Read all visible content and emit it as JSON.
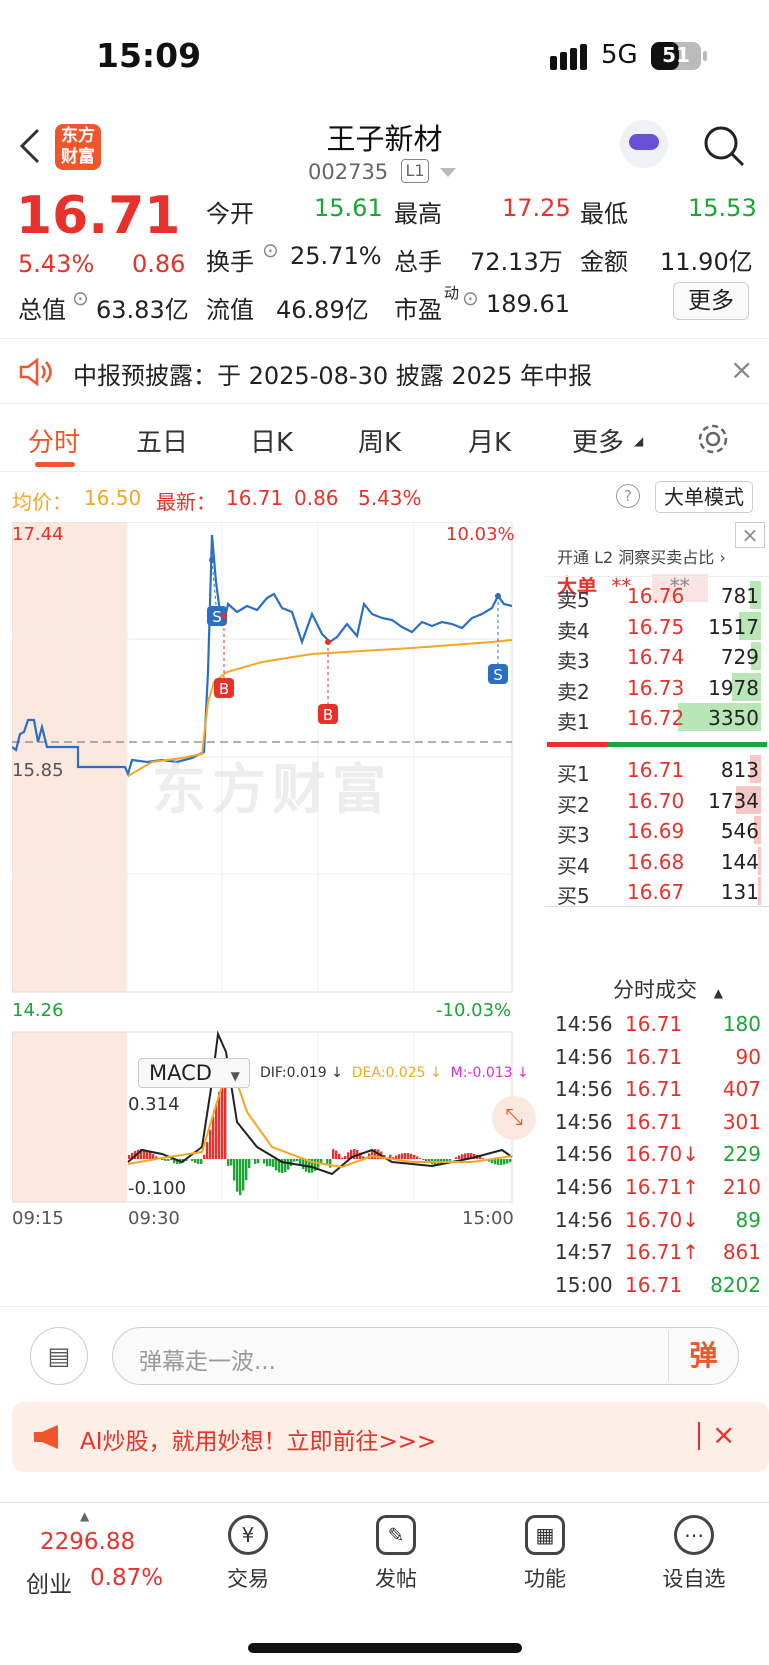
{
  "status": {
    "time": "15:09",
    "network": "5G",
    "battery": "51"
  },
  "header": {
    "logo_text": "东方财富",
    "stock_name": "王子新材",
    "stock_code": "002735",
    "level": "L1"
  },
  "quote": {
    "price": "16.71",
    "change_pct": "5.43%",
    "change": "0.86",
    "open_label": "今开",
    "open": "15.61",
    "high_label": "最高",
    "high": "17.25",
    "low_label": "最低",
    "low": "15.53",
    "turnover_label": "换手",
    "turnover": "25.71%",
    "volume_label": "总手",
    "volume": "72.13万",
    "amount_label": "金额",
    "amount": "11.90亿",
    "mktcap_label": "总值",
    "mktcap": "63.83亿",
    "float_label": "流值",
    "float": "46.89亿",
    "pe_label": "市盈",
    "pe_sup": "动",
    "pe": "189.61",
    "more": "更多"
  },
  "notice": {
    "text": "中报预披露：于 2025-08-30 披露 2025 年中报"
  },
  "tabs": [
    "分时",
    "五日",
    "日K",
    "周K",
    "月K",
    "更多"
  ],
  "info": {
    "avg_label": "均价：",
    "avg": "16.50",
    "latest_label": "最新：",
    "latest": "16.71",
    "chg": "0.86",
    "pct": "5.43%",
    "mode_btn": "大单模式",
    "help": "?"
  },
  "chart_data": {
    "type": "line",
    "y_max": "17.44",
    "y_min": "14.26",
    "pct_max": "10.03%",
    "pct_min": "-10.03%",
    "prev_close": "15.85",
    "times": [
      "09:15",
      "09:30",
      "15:00"
    ],
    "watermark": "东方财富",
    "macd": {
      "selector": "MACD",
      "dif": "DIF:0.019 ↓",
      "dea": "DEA:0.025 ↓",
      "m": "M:-0.013 ↓",
      "top": "0.314",
      "bottom": "-0.100"
    },
    "markers": [
      "S",
      "B",
      "B",
      "S"
    ],
    "colors": {
      "price": "#2a6fc4",
      "avg": "#f5a623",
      "up": "#e8312b",
      "down": "#1aa534"
    }
  },
  "book": {
    "banner": "开通 L2 洞察买卖占比 ›",
    "dd_label": "大单",
    "dd_v1": "**",
    "dd_v2": "**",
    "sells": [
      {
        "label": "卖5",
        "price": "16.76",
        "vol": "781",
        "fill": 0.12
      },
      {
        "label": "卖4",
        "price": "16.75",
        "vol": "1517",
        "fill": 0.25
      },
      {
        "label": "卖3",
        "price": "16.74",
        "vol": "729",
        "fill": 0.11
      },
      {
        "label": "卖2",
        "price": "16.73",
        "vol": "1978",
        "fill": 0.32
      },
      {
        "label": "卖1",
        "price": "16.72",
        "vol": "3350",
        "fill": 0.92
      }
    ],
    "buys": [
      {
        "label": "买1",
        "price": "16.71",
        "vol": "813",
        "fill": 0.12
      },
      {
        "label": "买2",
        "price": "16.70",
        "vol": "1734",
        "fill": 0.28
      },
      {
        "label": "买3",
        "price": "16.69",
        "vol": "546",
        "fill": 0.08
      },
      {
        "label": "买4",
        "price": "16.68",
        "vol": "144",
        "fill": 0.03
      },
      {
        "label": "买5",
        "price": "16.67",
        "vol": "131",
        "fill": 0.03
      }
    ],
    "trades_title": "分时成交",
    "trades": [
      {
        "t": "14:56",
        "p": "16.71",
        "v": "180",
        "pc": "r",
        "vc": "g"
      },
      {
        "t": "14:56",
        "p": "16.71",
        "v": "90",
        "pc": "r",
        "vc": "r"
      },
      {
        "t": "14:56",
        "p": "16.71",
        "v": "407",
        "pc": "r",
        "vc": "r"
      },
      {
        "t": "14:56",
        "p": "16.71",
        "v": "301",
        "pc": "r",
        "vc": "r"
      },
      {
        "t": "14:56",
        "p": "16.70↓",
        "v": "229",
        "pc": "r",
        "vc": "g"
      },
      {
        "t": "14:56",
        "p": "16.71↑",
        "v": "210",
        "pc": "r",
        "vc": "r"
      },
      {
        "t": "14:56",
        "p": "16.70↓",
        "v": "89",
        "pc": "r",
        "vc": "g"
      },
      {
        "t": "14:57",
        "p": "16.71↑",
        "v": "861",
        "pc": "r",
        "vc": "r"
      },
      {
        "t": "15:00",
        "p": "16.71",
        "v": "8202",
        "pc": "r",
        "vc": "g"
      }
    ]
  },
  "danmu": {
    "placeholder": "弹幕走一波...",
    "send": "弹"
  },
  "ai": {
    "text": "AI炒股，就用妙想！立即前往>>>"
  },
  "bottom": {
    "index_value": "2296.88",
    "index_name": "创业",
    "index_pct": "0.87%",
    "items": [
      "交易",
      "发帖",
      "功能",
      "设自选"
    ]
  }
}
